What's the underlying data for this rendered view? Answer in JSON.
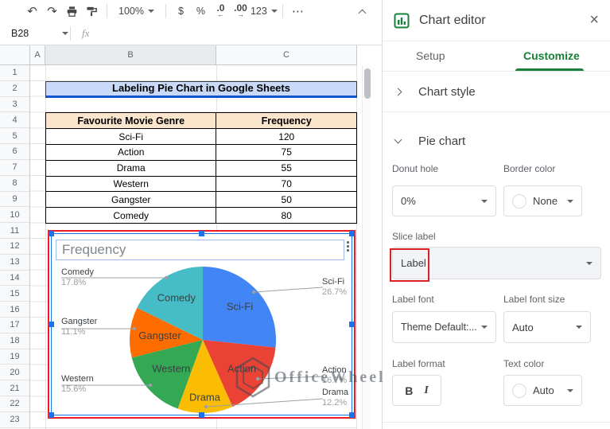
{
  "toolbar": {
    "zoom": "100%",
    "currency": "$",
    "percent": "%",
    "decrease_decimal": ".0",
    "increase_decimal": ".00",
    "number_format": "123",
    "more": "⋯"
  },
  "icons": {
    "undo": "↶",
    "redo": "↷",
    "close": "×"
  },
  "formula_bar": {
    "cell_reference": "B28",
    "fx_label": "fx",
    "formula_value": ""
  },
  "grid": {
    "columns": [
      "A",
      "B",
      "C"
    ],
    "selected_column": "B",
    "row_numbers": [
      "1",
      "2",
      "3",
      "4",
      "5",
      "6",
      "7",
      "8",
      "9",
      "10",
      "11",
      "12",
      "13",
      "14",
      "15",
      "16",
      "17",
      "18",
      "19",
      "20",
      "21",
      "22",
      "23"
    ]
  },
  "sheet": {
    "title": "Labeling Pie Chart in Google Sheets",
    "table": {
      "headers": [
        "Favourite Movie Genre",
        "Frequency"
      ],
      "rows": [
        [
          "Sci-Fi",
          "120"
        ],
        [
          "Action",
          "75"
        ],
        [
          "Drama",
          "55"
        ],
        [
          "Western",
          "70"
        ],
        [
          "Gangster",
          "50"
        ],
        [
          "Comedy",
          "80"
        ]
      ]
    }
  },
  "chart_data": {
    "type": "pie",
    "title": "Frequency",
    "categories": [
      "Sci-Fi",
      "Action",
      "Drama",
      "Western",
      "Gangster",
      "Comedy"
    ],
    "values": [
      120,
      75,
      55,
      70,
      50,
      80
    ],
    "percent_labels": [
      "26.7%",
      "16.7%",
      "12.2%",
      "15.6%",
      "11.1%",
      "17.8%"
    ],
    "colors": [
      "#4285f4",
      "#ea4335",
      "#fbbc04",
      "#34a853",
      "#ff6d01",
      "#46bdc6"
    ],
    "slice_label_mode": "Label",
    "legend_position": "labeled-callouts",
    "start_angle_deg": 0,
    "direction": "clockwise"
  },
  "watermark": {
    "text": "OfficeWheel"
  },
  "panel": {
    "title": "Chart editor",
    "tabs": {
      "setup": "Setup",
      "customize": "Customize"
    },
    "chart_style_label": "Chart style",
    "pie_chart_label": "Pie chart",
    "donut_hole": {
      "label": "Donut hole",
      "value": "0%"
    },
    "border_color": {
      "label": "Border color",
      "value": "None"
    },
    "slice_label": {
      "label": "Slice label",
      "value": "Label"
    },
    "label_font": {
      "label": "Label font",
      "value": "Theme Default:..."
    },
    "label_font_size": {
      "label": "Label font size",
      "value": "Auto"
    },
    "label_format": {
      "label": "Label format",
      "bold": "B",
      "italic": "I"
    },
    "text_color": {
      "label": "Text color",
      "value": "Auto"
    }
  },
  "colors": {
    "accent_green": "#188038",
    "selection_blue": "#1a73e8",
    "annotation_red": "#dd2025",
    "title_cell_bg": "#c9daf8",
    "title_cell_border": "#1155cc",
    "table_header_bg": "#fce5cd"
  }
}
